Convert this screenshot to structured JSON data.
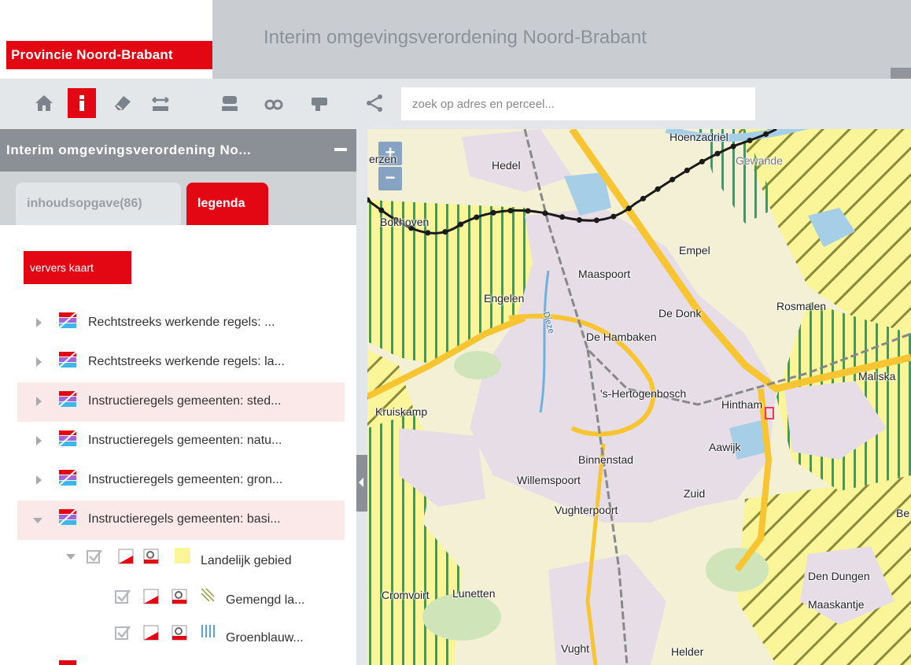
{
  "header": {
    "logo_text": "Provincie Noord-Brabant",
    "title": "Interim omgevingsverordening Noord-Brabant"
  },
  "toolbar": {
    "buttons": [
      {
        "name": "home-icon"
      },
      {
        "name": "info-icon",
        "active": true
      },
      {
        "name": "eraser-icon"
      },
      {
        "name": "measure-distance-icon"
      },
      {
        "name": "measure-area-icon"
      },
      {
        "name": "binoculars-icon"
      },
      {
        "name": "print-icon"
      },
      {
        "name": "share-icon"
      }
    ],
    "search_placeholder": "zoek op adres en perceel..."
  },
  "panel": {
    "title": "Interim omgevingsverordening No...",
    "tabs": [
      {
        "label": "inhoudsopgave(86)"
      },
      {
        "label": "legenda",
        "active": true
      }
    ],
    "refresh_label": "ververs kaart",
    "layers": [
      {
        "label": "Rechtstreeks werkende regels: ...",
        "expanded": false,
        "highlighted": false
      },
      {
        "label": "Rechtstreeks werkende regels: la...",
        "expanded": false,
        "highlighted": false
      },
      {
        "label": "Instructieregels gemeenten: sted...",
        "expanded": false,
        "highlighted": true
      },
      {
        "label": "Instructieregels gemeenten: natu...",
        "expanded": false,
        "highlighted": false
      },
      {
        "label": "Instructieregels gemeenten: gron...",
        "expanded": false,
        "highlighted": false
      },
      {
        "label": "Instructieregels gemeenten: basi...",
        "expanded": true,
        "highlighted": true
      }
    ],
    "sublayers": [
      {
        "label": "Landelijk gebied",
        "legend": "yellow-fill"
      },
      {
        "label": "Gemengd la...",
        "legend": "diagonal-hatch"
      },
      {
        "label": "Groenblauw...",
        "legend": "vertical-stripes"
      }
    ]
  },
  "map": {
    "zoom_in": "+",
    "zoom_out": "−",
    "places": [
      "Hoenzadriel",
      "Hedel",
      "Empel",
      "Maaspoort",
      "Rosmalen",
      "De Donk",
      "De Hambaken",
      "'s-Hertogenbosch",
      "Hintham",
      "Maliska",
      "Kruiskamp",
      "Binnenstad",
      "Aawijk",
      "Willemspoort",
      "Zuid",
      "Vughterpoort",
      "Den Dungen",
      "Maaskantje",
      "Vught",
      "Helder",
      "Lunetten",
      "Cromvoirt",
      "Engelen",
      "Bokhoven",
      "Gewande",
      "erzen",
      "Be",
      "Dieze"
    ],
    "colors": {
      "urban": "#e6dde7",
      "rural_yellow": "#fbf59a",
      "green_stripe": "#29a36b",
      "hatch": "#8a8a3a",
      "highway": "#f7c531",
      "water": "#a6cee6"
    }
  },
  "colors": {
    "accent": "#e30613",
    "header_grey": "#c9cdd1",
    "panel_grey": "#8a9096"
  }
}
